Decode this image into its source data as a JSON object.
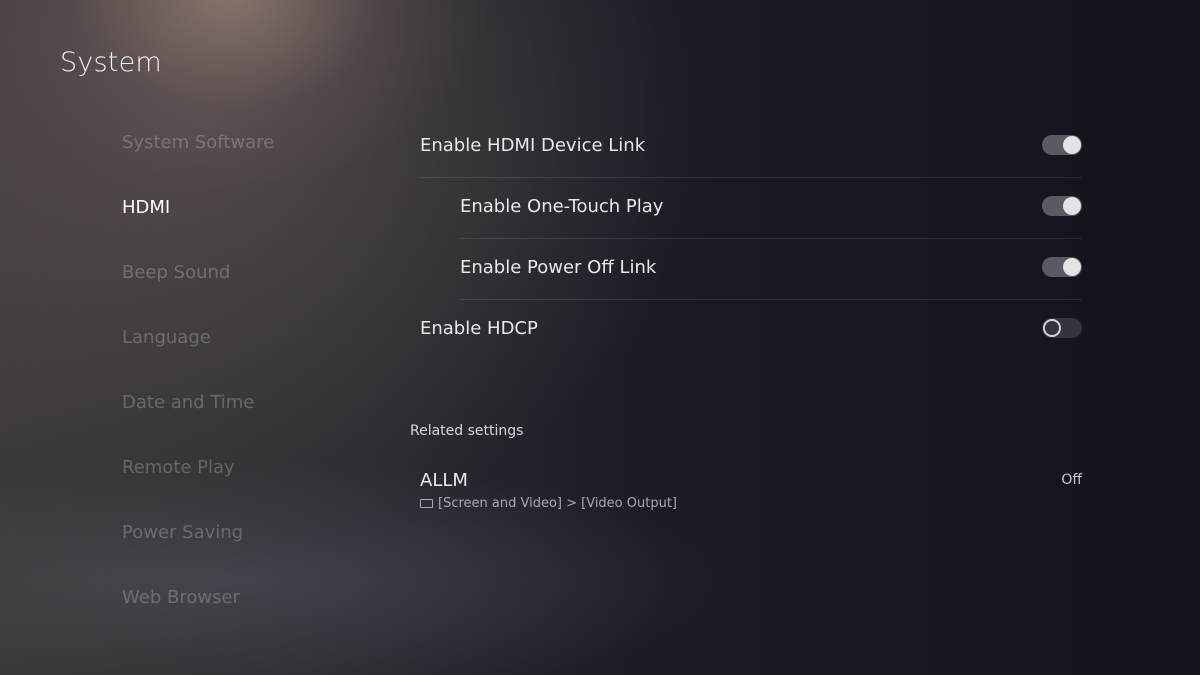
{
  "page": {
    "title": "System"
  },
  "sidebar": {
    "items": [
      {
        "label": "System Software",
        "active": false
      },
      {
        "label": "HDMI",
        "active": true
      },
      {
        "label": "Beep Sound",
        "active": false
      },
      {
        "label": "Language",
        "active": false
      },
      {
        "label": "Date and Time",
        "active": false
      },
      {
        "label": "Remote Play",
        "active": false
      },
      {
        "label": "Power Saving",
        "active": false
      },
      {
        "label": "Web Browser",
        "active": false
      }
    ]
  },
  "settings": [
    {
      "label": "Enable HDMI Device Link",
      "enabled": true,
      "sub": false
    },
    {
      "label": "Enable One-Touch Play",
      "enabled": true,
      "sub": true
    },
    {
      "label": "Enable Power Off Link",
      "enabled": true,
      "sub": true
    },
    {
      "label": "Enable HDCP",
      "enabled": false,
      "sub": false
    }
  ],
  "related": {
    "heading": "Related settings",
    "items": [
      {
        "name": "ALLM",
        "value": "Off",
        "icon": "screen-icon",
        "path": "[Screen and Video] > [Video Output]"
      }
    ]
  }
}
